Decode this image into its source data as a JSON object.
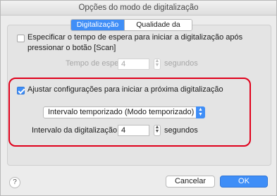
{
  "window": {
    "title": "Opções do modo de digitalização"
  },
  "tabs": [
    {
      "label": "Digitalização",
      "active": true
    },
    {
      "label": "Qualidade da imagem",
      "active": false
    }
  ],
  "wait_section": {
    "checkbox_label_line1": "Especificar o tempo de espera para iniciar a digitalização após",
    "checkbox_label_line2": "pressionar o botão [Scan]",
    "checked": false,
    "wait_time_label": "Tempo de espera:",
    "wait_time_value": "4",
    "wait_time_unit": "segundos"
  },
  "adjust_section": {
    "checkbox_label": "Ajustar configurações para iniciar a próxima digitalização",
    "checked": true,
    "mode_select_value": "Intervalo temporizado (Modo temporizado)",
    "interval_label": "Intervalo da digitalização:",
    "interval_value": "4",
    "interval_unit": "segundos"
  },
  "footer": {
    "help_label": "?",
    "cancel_label": "Cancelar",
    "ok_label": "OK"
  },
  "colors": {
    "accent": "#3f8ef7",
    "highlight": "#e0001b"
  }
}
